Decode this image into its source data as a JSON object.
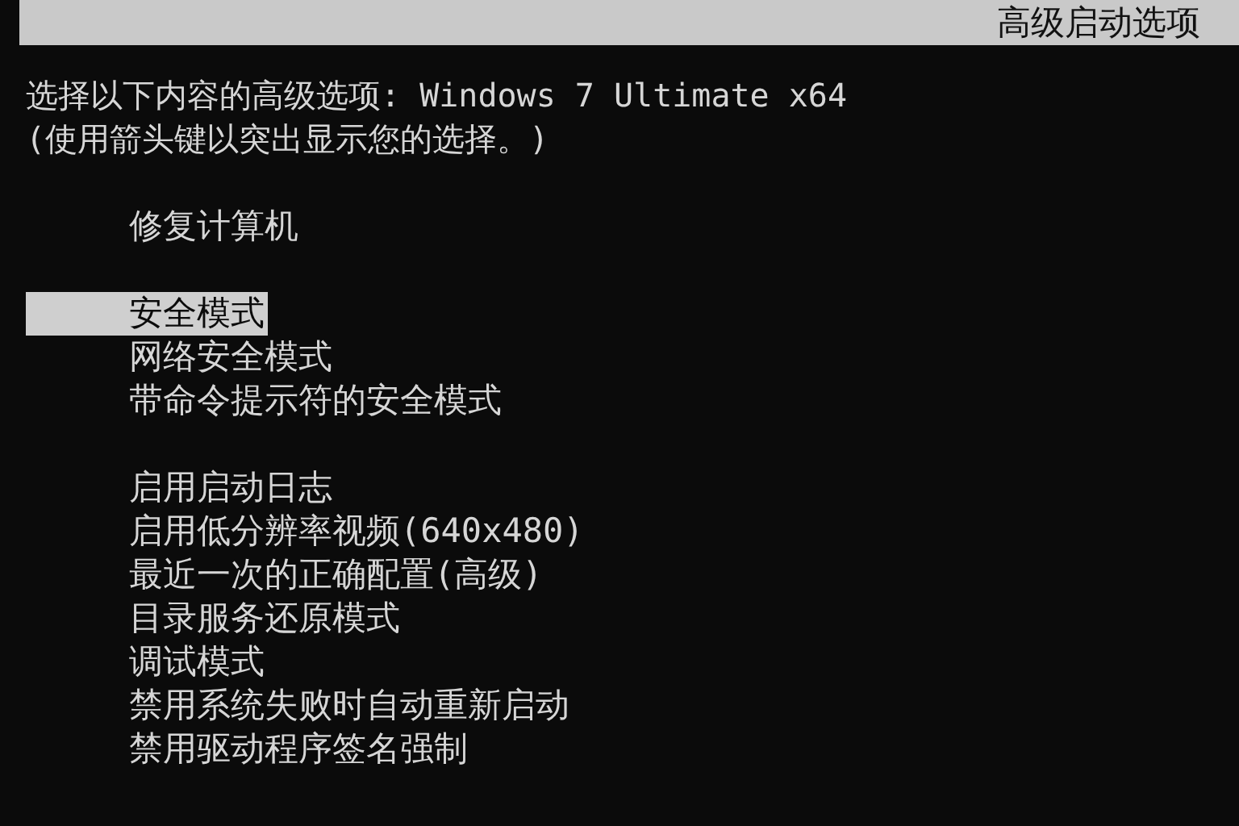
{
  "header": {
    "title": "高级启动选项"
  },
  "prompt": "选择以下内容的高级选项: Windows 7 Ultimate x64",
  "hint": "(使用箭头键以突出显示您的选择。)",
  "groups": [
    {
      "items": [
        {
          "label": "修复计算机",
          "selected": false
        }
      ]
    },
    {
      "items": [
        {
          "label": "安全模式",
          "selected": true
        },
        {
          "label": "网络安全模式",
          "selected": false
        },
        {
          "label": "带命令提示符的安全模式",
          "selected": false
        }
      ]
    },
    {
      "items": [
        {
          "label": "启用启动日志",
          "selected": false
        },
        {
          "label": "启用低分辨率视频(640x480)",
          "selected": false
        },
        {
          "label": "最近一次的正确配置(高级)",
          "selected": false
        },
        {
          "label": "目录服务还原模式",
          "selected": false
        },
        {
          "label": "调试模式",
          "selected": false
        },
        {
          "label": "禁用系统失败时自动重新启动",
          "selected": false
        },
        {
          "label": "禁用驱动程序签名强制",
          "selected": false
        }
      ]
    }
  ]
}
